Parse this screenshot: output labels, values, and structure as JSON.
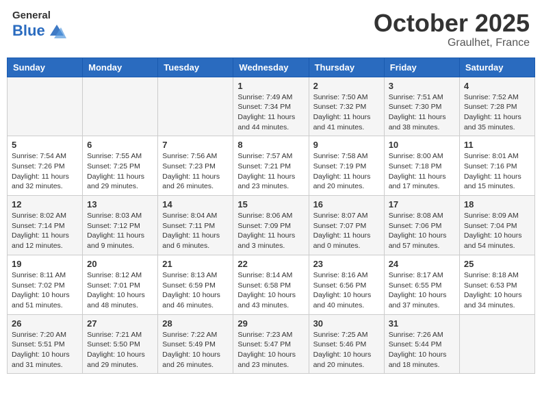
{
  "header": {
    "logo_line1": "General",
    "logo_line2": "Blue",
    "month": "October 2025",
    "location": "Graulhet, France"
  },
  "weekdays": [
    "Sunday",
    "Monday",
    "Tuesday",
    "Wednesday",
    "Thursday",
    "Friday",
    "Saturday"
  ],
  "weeks": [
    [
      {
        "day": "",
        "sunrise": "",
        "sunset": "",
        "daylight": ""
      },
      {
        "day": "",
        "sunrise": "",
        "sunset": "",
        "daylight": ""
      },
      {
        "day": "",
        "sunrise": "",
        "sunset": "",
        "daylight": ""
      },
      {
        "day": "1",
        "sunrise": "Sunrise: 7:49 AM",
        "sunset": "Sunset: 7:34 PM",
        "daylight": "Daylight: 11 hours and 44 minutes."
      },
      {
        "day": "2",
        "sunrise": "Sunrise: 7:50 AM",
        "sunset": "Sunset: 7:32 PM",
        "daylight": "Daylight: 11 hours and 41 minutes."
      },
      {
        "day": "3",
        "sunrise": "Sunrise: 7:51 AM",
        "sunset": "Sunset: 7:30 PM",
        "daylight": "Daylight: 11 hours and 38 minutes."
      },
      {
        "day": "4",
        "sunrise": "Sunrise: 7:52 AM",
        "sunset": "Sunset: 7:28 PM",
        "daylight": "Daylight: 11 hours and 35 minutes."
      }
    ],
    [
      {
        "day": "5",
        "sunrise": "Sunrise: 7:54 AM",
        "sunset": "Sunset: 7:26 PM",
        "daylight": "Daylight: 11 hours and 32 minutes."
      },
      {
        "day": "6",
        "sunrise": "Sunrise: 7:55 AM",
        "sunset": "Sunset: 7:25 PM",
        "daylight": "Daylight: 11 hours and 29 minutes."
      },
      {
        "day": "7",
        "sunrise": "Sunrise: 7:56 AM",
        "sunset": "Sunset: 7:23 PM",
        "daylight": "Daylight: 11 hours and 26 minutes."
      },
      {
        "day": "8",
        "sunrise": "Sunrise: 7:57 AM",
        "sunset": "Sunset: 7:21 PM",
        "daylight": "Daylight: 11 hours and 23 minutes."
      },
      {
        "day": "9",
        "sunrise": "Sunrise: 7:58 AM",
        "sunset": "Sunset: 7:19 PM",
        "daylight": "Daylight: 11 hours and 20 minutes."
      },
      {
        "day": "10",
        "sunrise": "Sunrise: 8:00 AM",
        "sunset": "Sunset: 7:18 PM",
        "daylight": "Daylight: 11 hours and 17 minutes."
      },
      {
        "day": "11",
        "sunrise": "Sunrise: 8:01 AM",
        "sunset": "Sunset: 7:16 PM",
        "daylight": "Daylight: 11 hours and 15 minutes."
      }
    ],
    [
      {
        "day": "12",
        "sunrise": "Sunrise: 8:02 AM",
        "sunset": "Sunset: 7:14 PM",
        "daylight": "Daylight: 11 hours and 12 minutes."
      },
      {
        "day": "13",
        "sunrise": "Sunrise: 8:03 AM",
        "sunset": "Sunset: 7:12 PM",
        "daylight": "Daylight: 11 hours and 9 minutes."
      },
      {
        "day": "14",
        "sunrise": "Sunrise: 8:04 AM",
        "sunset": "Sunset: 7:11 PM",
        "daylight": "Daylight: 11 hours and 6 minutes."
      },
      {
        "day": "15",
        "sunrise": "Sunrise: 8:06 AM",
        "sunset": "Sunset: 7:09 PM",
        "daylight": "Daylight: 11 hours and 3 minutes."
      },
      {
        "day": "16",
        "sunrise": "Sunrise: 8:07 AM",
        "sunset": "Sunset: 7:07 PM",
        "daylight": "Daylight: 11 hours and 0 minutes."
      },
      {
        "day": "17",
        "sunrise": "Sunrise: 8:08 AM",
        "sunset": "Sunset: 7:06 PM",
        "daylight": "Daylight: 10 hours and 57 minutes."
      },
      {
        "day": "18",
        "sunrise": "Sunrise: 8:09 AM",
        "sunset": "Sunset: 7:04 PM",
        "daylight": "Daylight: 10 hours and 54 minutes."
      }
    ],
    [
      {
        "day": "19",
        "sunrise": "Sunrise: 8:11 AM",
        "sunset": "Sunset: 7:02 PM",
        "daylight": "Daylight: 10 hours and 51 minutes."
      },
      {
        "day": "20",
        "sunrise": "Sunrise: 8:12 AM",
        "sunset": "Sunset: 7:01 PM",
        "daylight": "Daylight: 10 hours and 48 minutes."
      },
      {
        "day": "21",
        "sunrise": "Sunrise: 8:13 AM",
        "sunset": "Sunset: 6:59 PM",
        "daylight": "Daylight: 10 hours and 46 minutes."
      },
      {
        "day": "22",
        "sunrise": "Sunrise: 8:14 AM",
        "sunset": "Sunset: 6:58 PM",
        "daylight": "Daylight: 10 hours and 43 minutes."
      },
      {
        "day": "23",
        "sunrise": "Sunrise: 8:16 AM",
        "sunset": "Sunset: 6:56 PM",
        "daylight": "Daylight: 10 hours and 40 minutes."
      },
      {
        "day": "24",
        "sunrise": "Sunrise: 8:17 AM",
        "sunset": "Sunset: 6:55 PM",
        "daylight": "Daylight: 10 hours and 37 minutes."
      },
      {
        "day": "25",
        "sunrise": "Sunrise: 8:18 AM",
        "sunset": "Sunset: 6:53 PM",
        "daylight": "Daylight: 10 hours and 34 minutes."
      }
    ],
    [
      {
        "day": "26",
        "sunrise": "Sunrise: 7:20 AM",
        "sunset": "Sunset: 5:51 PM",
        "daylight": "Daylight: 10 hours and 31 minutes."
      },
      {
        "day": "27",
        "sunrise": "Sunrise: 7:21 AM",
        "sunset": "Sunset: 5:50 PM",
        "daylight": "Daylight: 10 hours and 29 minutes."
      },
      {
        "day": "28",
        "sunrise": "Sunrise: 7:22 AM",
        "sunset": "Sunset: 5:49 PM",
        "daylight": "Daylight: 10 hours and 26 minutes."
      },
      {
        "day": "29",
        "sunrise": "Sunrise: 7:23 AM",
        "sunset": "Sunset: 5:47 PM",
        "daylight": "Daylight: 10 hours and 23 minutes."
      },
      {
        "day": "30",
        "sunrise": "Sunrise: 7:25 AM",
        "sunset": "Sunset: 5:46 PM",
        "daylight": "Daylight: 10 hours and 20 minutes."
      },
      {
        "day": "31",
        "sunrise": "Sunrise: 7:26 AM",
        "sunset": "Sunset: 5:44 PM",
        "daylight": "Daylight: 10 hours and 18 minutes."
      },
      {
        "day": "",
        "sunrise": "",
        "sunset": "",
        "daylight": ""
      }
    ]
  ]
}
